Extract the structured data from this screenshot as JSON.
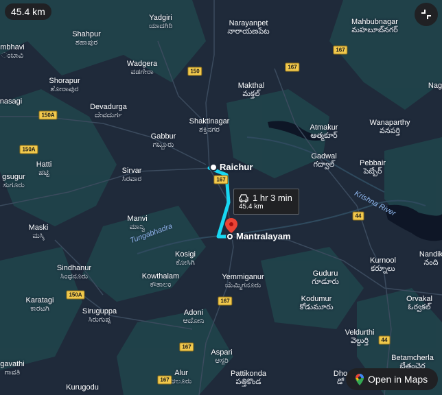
{
  "map": {
    "distance_badge": "45.4 km",
    "fullscreen_icon": "fullscreen-exit-icon",
    "colors": {
      "land": "#1f2a3a",
      "vegetation": "#20444b",
      "water": "#0e1626",
      "route": "#18d7f2",
      "marker": "#ea4335",
      "highway_shield": "#f2c94c"
    },
    "places": [
      {
        "name": "Yadgiri",
        "local": "ಯಾದಗಿರಿ"
      },
      {
        "name": "Narayanpet",
        "local": "నారాయణపేట"
      },
      {
        "name": "Mahbubnagar",
        "local": "మహబూబ్‌నగర్"
      },
      {
        "name": "Shahpur",
        "local": "ಶಹಾಪುರ"
      },
      {
        "name": "mbhavi",
        "local": "ಂಬಾವಿ"
      },
      {
        "name": "Wadgera",
        "local": "ವಡಗೇರಾ"
      },
      {
        "name": "Shorapur",
        "local": "ಶೋರಾಪುರ"
      },
      {
        "name": "Makthal",
        "local": "మక్తల్"
      },
      {
        "name": "Nag",
        "local": ""
      },
      {
        "name": "nasagi",
        "local": ""
      },
      {
        "name": "Devadurga",
        "local": "ದೇವದುರ್ಗ"
      },
      {
        "name": "Shaktinagar",
        "local": "ಶಕ್ತಿನಗರ"
      },
      {
        "name": "Atmakur",
        "local": "ఆత్మకూర్"
      },
      {
        "name": "Wanaparthy",
        "local": "వనపర్తి"
      },
      {
        "name": "Gabbur",
        "local": "ಗಬ್ಬೂರು"
      },
      {
        "name": "Hatti",
        "local": "ಹಟ್ಟಿ"
      },
      {
        "name": "Gadwal",
        "local": "గద్వాల్"
      },
      {
        "name": "Pebbair",
        "local": "పెబ్బేర్"
      },
      {
        "name": "gsugur",
        "local": "ಸುಗೂರು"
      },
      {
        "name": "Sirvar",
        "local": "ಸಿರವಾರ"
      },
      {
        "name": "Maski",
        "local": "ಮಸ್ಕಿ"
      },
      {
        "name": "Manvi",
        "local": "ಮಾನ್ವಿ"
      },
      {
        "name": "Kosigi",
        "local": "ಕೋಸಿಗಿ"
      },
      {
        "name": "Sindhanur",
        "local": "ಸಿಂಧನೂರು"
      },
      {
        "name": "Kowthalam",
        "local": "ಕೌತಾಲಂ"
      },
      {
        "name": "Yemmiganur",
        "local": "ಯೆಮ್ಮಿಗನೂರು"
      },
      {
        "name": "Guduru",
        "local": "గూడూరు"
      },
      {
        "name": "Kurnool",
        "local": "కర్నూలు"
      },
      {
        "name": "Nandik",
        "local": "నంది"
      },
      {
        "name": "Karatagi",
        "local": "ಕಾರಟಗಿ"
      },
      {
        "name": "Siruguppa",
        "local": "ಸಿರುಗುಪ್ಪ"
      },
      {
        "name": "Adoni",
        "local": "ಆದೋನಿ"
      },
      {
        "name": "Kodumur",
        "local": "కోడుమూరు"
      },
      {
        "name": "Orvakal",
        "local": "ఓర్వకల్"
      },
      {
        "name": "Veldurthi",
        "local": "వెల్దుర్తి"
      },
      {
        "name": "gavathi",
        "local": "ಗಾವತಿ"
      },
      {
        "name": "Aspari",
        "local": "ಆಸ್ಪರಿ"
      },
      {
        "name": "Alur",
        "local": "ಆಲೂರು"
      },
      {
        "name": "Pattikonda",
        "local": "పత్తికొండ"
      },
      {
        "name": "Betamcherla",
        "local": "బేతంచెర్ల"
      },
      {
        "name": "Kurugodu",
        "local": ""
      },
      {
        "name": "Dho",
        "local": "డో"
      }
    ],
    "highways": [
      "150",
      "167",
      "167",
      "150A",
      "150A",
      "167",
      "44",
      "150A",
      "167",
      "167",
      "44",
      "167"
    ],
    "rivers": [
      "Tungabhadra",
      "Krishna River"
    ],
    "origin": {
      "name": "Raichur"
    },
    "destination": {
      "name": "Mantralayam"
    },
    "route_info": {
      "time": "1 hr 3 min",
      "distance": "45.4 km",
      "mode_icon": "car-icon"
    },
    "open_in_maps": {
      "label": "Open in Maps",
      "icon": "google-maps-pin-icon"
    }
  }
}
